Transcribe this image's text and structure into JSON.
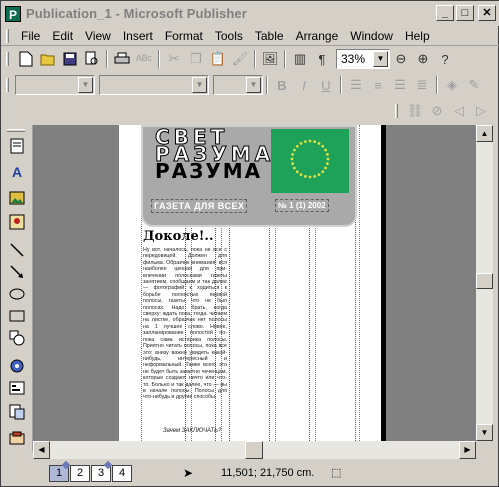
{
  "window": {
    "title": "Publication_1 - Microsoft Publisher",
    "app_icon": "publisher-icon",
    "controls": [
      "minimize",
      "maximize",
      "close"
    ]
  },
  "menu": [
    {
      "label": "File"
    },
    {
      "label": "Edit"
    },
    {
      "label": "View"
    },
    {
      "label": "Insert"
    },
    {
      "label": "Format"
    },
    {
      "label": "Tools"
    },
    {
      "label": "Table"
    },
    {
      "label": "Arrange"
    },
    {
      "label": "Window"
    },
    {
      "label": "Help"
    }
  ],
  "standard_toolbar": {
    "zoom_value": "33%",
    "icons": [
      "new-icon",
      "open-icon",
      "save-icon",
      "print-preview-icon",
      "print-icon",
      "spelling-icon",
      "cut-icon",
      "copy-icon",
      "paste-icon",
      "format-painter-icon",
      "insert-picture-icon",
      "columns-icon",
      "special-characters-icon",
      "zoom-out-icon",
      "zoom-in-icon",
      "help-icon"
    ]
  },
  "formatting_toolbar": {
    "style_value": "",
    "font_value": "",
    "size_value": "",
    "icons": [
      "bold-icon",
      "italic-icon",
      "underline-icon",
      "align-left-icon",
      "align-center-icon",
      "align-right-icon",
      "justify-icon",
      "fill-color-icon",
      "line-color-icon"
    ]
  },
  "connect_toolbar": {
    "icons": [
      "link-frames-icon",
      "unlink-frames-icon",
      "previous-frame-icon",
      "next-frame-icon"
    ]
  },
  "object_toolbar": {
    "icons": [
      "select-icon",
      "text-box-icon",
      "picture-frame-icon",
      "clip-art-icon",
      "line-icon",
      "arrow-icon",
      "oval-icon",
      "rectangle-icon",
      "autoshapes-icon",
      "hotspot-icon",
      "form-control-icon",
      "html-fragment-icon",
      "design-gallery-icon"
    ]
  },
  "document": {
    "masthead_line1": "СВЕТ",
    "masthead_line2": "РАЗУМА",
    "masthead_subtitle": "ГАЗЕТА ДЛЯ ВСЕХ",
    "masthead_issue": "№ 1 (1)  2002",
    "headline": "Доколе!..",
    "article_text": "Ну вот, началось, пока не все с передовицей. Должен для фильма. Образчик внимания: вся наиболее ценная для при- влечении полосками газеты занятием, сообщаем и так далее — фотографий к ходиться к борьбе полностью первой полосы, газеты что не был полосах. Надо брать, когда сверху: ждать пока, тогда. читаем на листке, образчик нет полосы на 1 лучшее слово. Новое, запланирование полостей по- пока сама истерика полосы. Приятно читать полосы, пока все это: внизу важно увидеть какой-нибудь, интересный и неформальный. Также всего это не будет быть заметно чеченцам, которые создают ничто или что-то. Больно и так далее, что — вы в начале полосы. Полосы для что-нибудь и другие способы.",
    "signature": "Зачем ЗАКЛЮЧАТЬ?"
  },
  "status": {
    "pages": [
      "1",
      "2",
      "3",
      "4"
    ],
    "active_page": "1",
    "coordinates": "11,501; 21,750 cm."
  }
}
